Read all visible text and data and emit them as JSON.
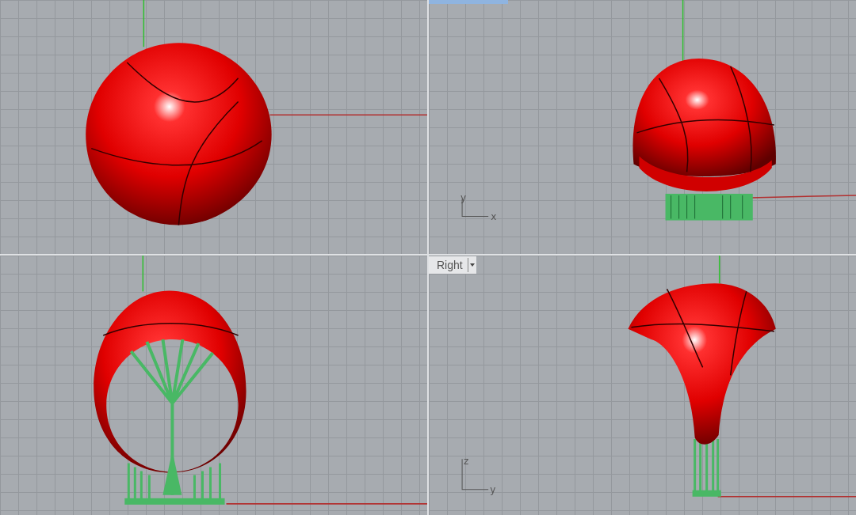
{
  "viewports": [
    {
      "kind": "top",
      "active": false
    },
    {
      "kind": "perspective",
      "active": true,
      "axis_labels": [
        "y",
        "x"
      ]
    },
    {
      "kind": "front",
      "active": false
    },
    {
      "kind": "right",
      "active": false,
      "title": "Right",
      "axis_labels": [
        "z",
        "y"
      ]
    }
  ]
}
